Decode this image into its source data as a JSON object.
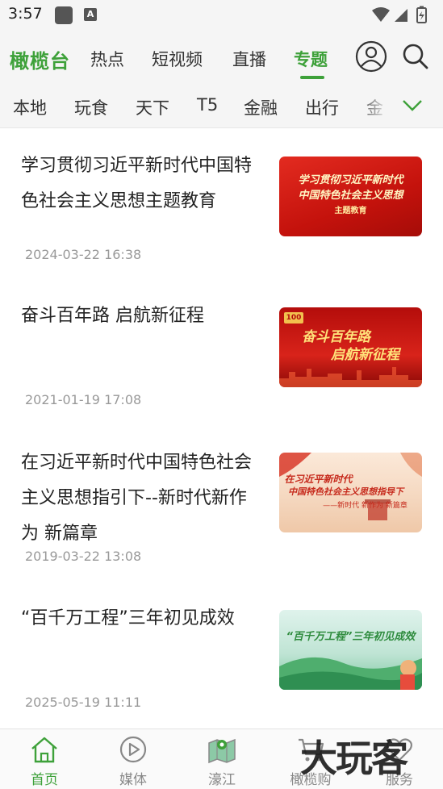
{
  "status_bar": {
    "time": "3:57",
    "app_icon_glyph": "A"
  },
  "top_nav": {
    "logo": "橄榄台",
    "tabs": [
      "热点",
      "短视频",
      "直播",
      "专题"
    ],
    "active_tab": "专题"
  },
  "channels": [
    "本地",
    "玩食",
    "天下",
    "T5",
    "金融",
    "出行",
    "金"
  ],
  "articles": [
    {
      "title": "学习贯彻习近平新时代中国特色社会主义思想主题教育",
      "date": "2024-03-22 16:38",
      "thumb_line1": "学习贯彻习近平新时代",
      "thumb_line2": "中国特色社会主义思想",
      "thumb_line3": "主题教育"
    },
    {
      "title": "奋斗百年路 启航新征程",
      "date": "2021-01-19 17:08",
      "thumb_badge": "100",
      "thumb_line1": "奋斗百年路",
      "thumb_line2": "启航新征程"
    },
    {
      "title": "在习近平新时代中国特色社会主义思想指引下--新时代新作为 新篇章",
      "date": "2019-03-22 13:08",
      "thumb_line1": "在习近平新时代",
      "thumb_line2": "中国特色社会主义思想指导下",
      "thumb_line3": "——新时代 新作为 新篇章"
    },
    {
      "title": "“百千万工程”三年初见成效",
      "date": "2025-05-19 11:11",
      "thumb_line1": "“百千万工程”三年初见成效"
    }
  ],
  "bottom_nav": [
    {
      "label": "首页",
      "icon": "home-icon"
    },
    {
      "label": "媒体",
      "icon": "play-icon"
    },
    {
      "label": "濠江",
      "icon": "map-icon"
    },
    {
      "label": "橄榄购",
      "icon": "cart-icon"
    },
    {
      "label": "服务",
      "icon": "heart-icon"
    }
  ],
  "active_bottom": "首页",
  "watermark": "大玩客",
  "colors": {
    "accent": "#3ea13a",
    "background": "#f5f5f5",
    "date": "#999999"
  }
}
